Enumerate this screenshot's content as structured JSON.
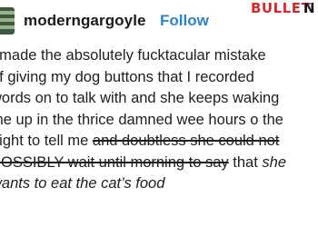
{
  "post": {
    "username": "moderngargoyle",
    "follow_label": "Follow",
    "lines": [
      [
        {
          "t": "I made the absolutely fucktacular mistake"
        }
      ],
      [
        {
          "t": "of giving my dog buttons that I recorded"
        }
      ],
      [
        {
          "t": "words on to talk with and she keeps waking"
        }
      ],
      [
        {
          "t": "me up in the thrice damned wee hours o the"
        }
      ],
      [
        {
          "t": "night to tell me "
        },
        {
          "t": "and doubtless she could not",
          "s": "strike"
        }
      ],
      [
        {
          "t": "POSSIBLY wait until morning to say",
          "s": "strike"
        },
        {
          "t": " that "
        },
        {
          "t": "she",
          "s": "ital"
        }
      ],
      [
        {
          "t": "wants to eat the cat’s food",
          "s": "ital"
        }
      ]
    ]
  },
  "watermark": {
    "brand_part1": "BULLET",
    "brand_part2": "N",
    "accent_color": "#d52a2a",
    "follow_color": "#2e83c7"
  }
}
